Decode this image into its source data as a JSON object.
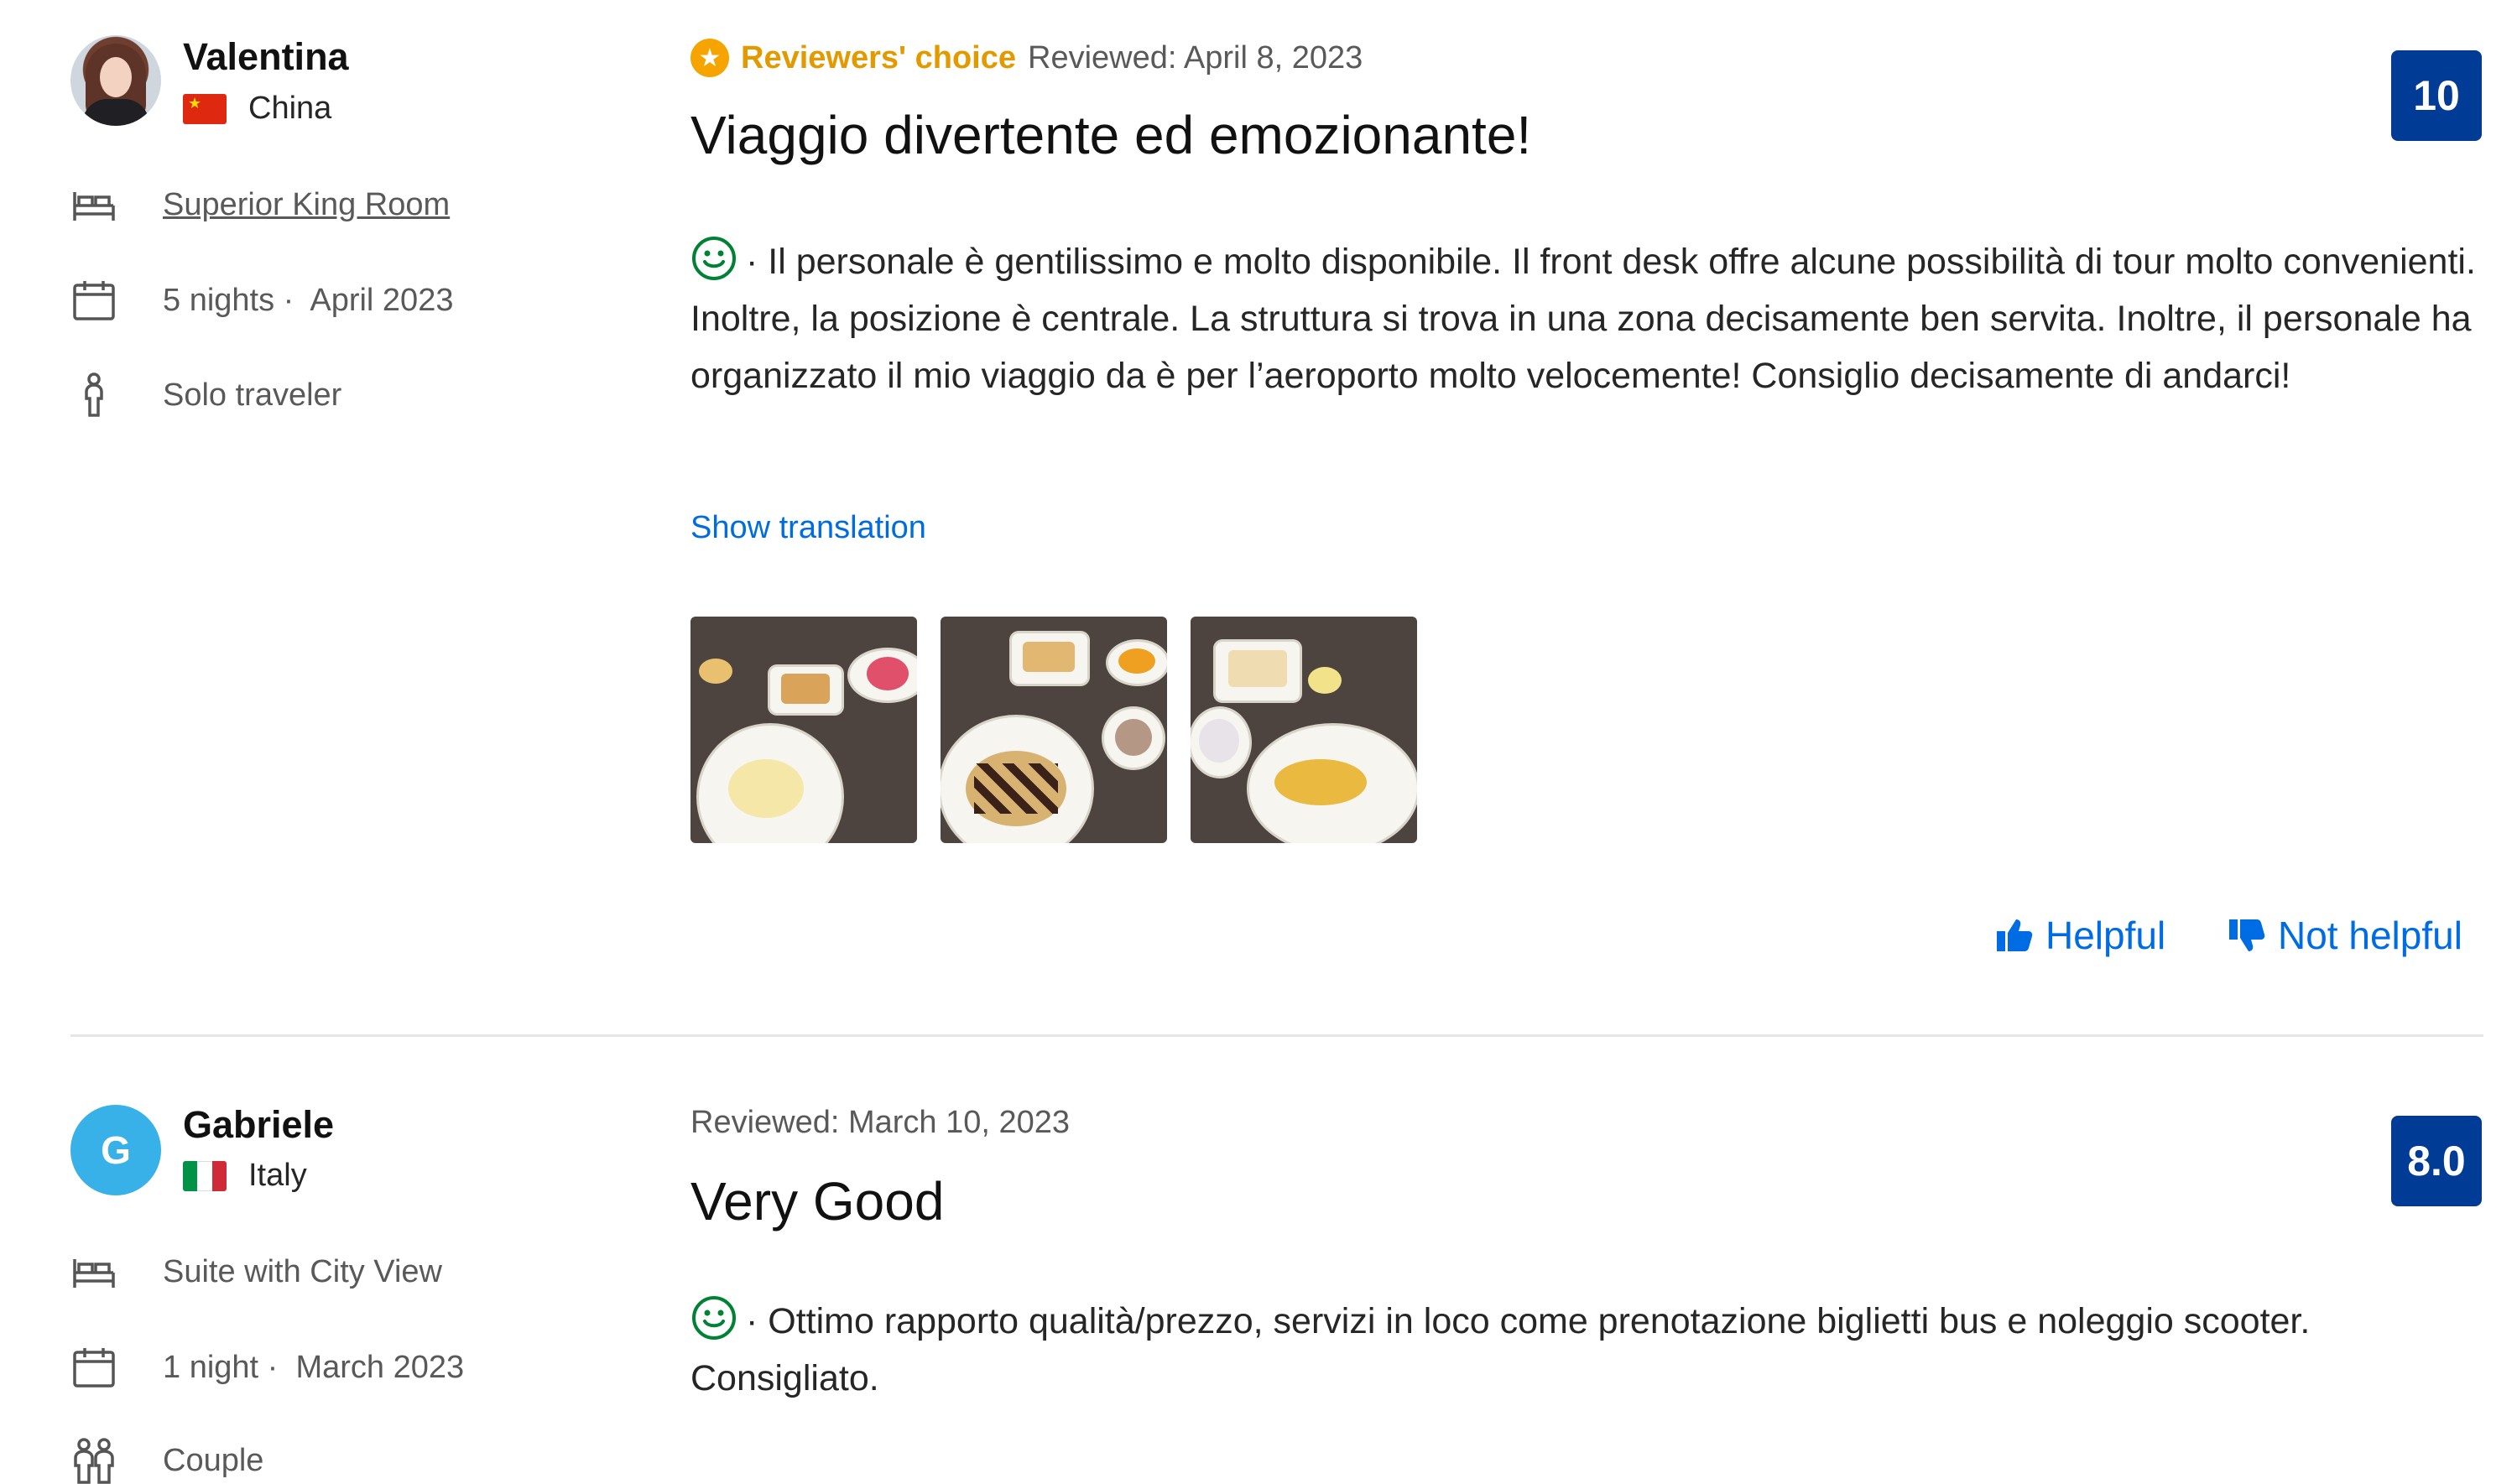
{
  "reviews": [
    {
      "user": {
        "name": "Valentina",
        "country": "China",
        "avatar_type": "photo"
      },
      "room": "Superior King Room",
      "stay": {
        "nights": "5 nights",
        "separator": "·",
        "month": "April 2023"
      },
      "traveler_type": "Solo traveler",
      "badge": "Reviewers' choice",
      "date": "Reviewed: April 8, 2023",
      "title": "Viaggio divertente ed emozionante!",
      "score": "10",
      "body": "· Il personale è gentilissimo e molto disponibile. Il front desk offre alcune possibilità di tour molto convenienti. Inoltre, la posizione è centrale. La struttura si trova in una zona decisamente ben servita. Inoltre, il personale ha organizzato il mio viaggio da è per l’aeroporto molto velocemente! Consiglio decisamente di andarci!",
      "show_translation": "Show translation",
      "photos": [
        "breakfast-photo-1",
        "breakfast-photo-2",
        "breakfast-photo-3"
      ],
      "helpful": "Helpful",
      "not_helpful": "Not helpful"
    },
    {
      "user": {
        "name": "Gabriele",
        "country": "Italy",
        "avatar_letter": "G"
      },
      "room": "Suite with City View",
      "stay": {
        "nights": "1 night",
        "separator": "·",
        "month": "March 2023"
      },
      "traveler_type": "Couple",
      "date": "Reviewed: March 10, 2023",
      "title": "Very Good",
      "score": "8.0",
      "body_line1": "· Ottimo rapporto qualità/prezzo, servizi in loco come prenotazione biglietti bus e noleggio scooter.",
      "body_line2": "Consigliato."
    }
  ],
  "colors": {
    "link": "#006ce4",
    "score_bg": "#003b95",
    "badge_gold": "#e39a00",
    "smiley_green": "#008234",
    "avatar_blue": "#38b0e8"
  }
}
